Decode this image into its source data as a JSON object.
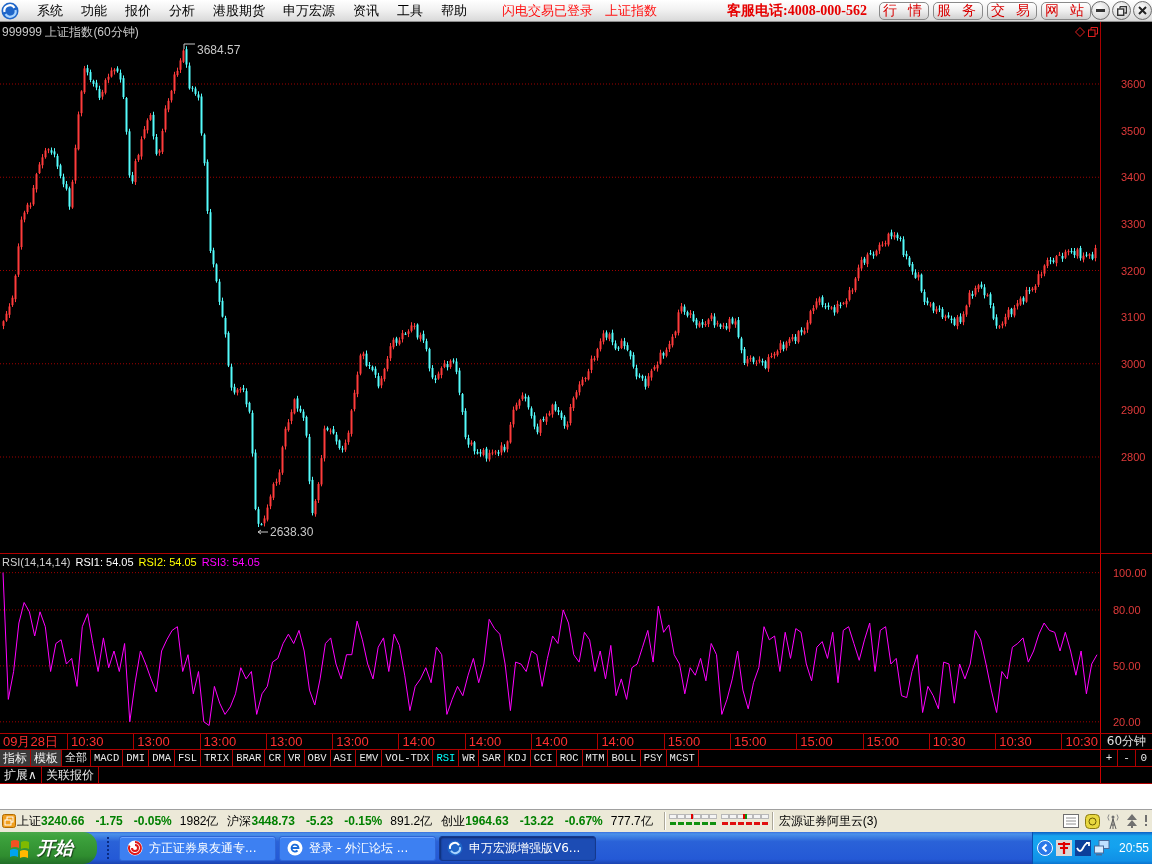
{
  "menu_bar": {
    "items": [
      "系统",
      "功能",
      "报价",
      "分析",
      "港股期货",
      "申万宏源",
      "资讯",
      "工具",
      "帮助"
    ],
    "login_status": "闪电交易已登录",
    "current_index": "上证指数",
    "hotline": "客服电话:4008-000-562",
    "service_buttons": [
      "行 情",
      "服 务",
      "交 易",
      "网 站"
    ]
  },
  "price_chart": {
    "title": "999999 上证指数(60分钟)",
    "high_label": "3684.57",
    "low_label": "2638.30",
    "axis_labels": [
      "3600",
      "3500",
      "3400",
      "3300",
      "3200",
      "3100",
      "3000",
      "2900",
      "2800"
    ]
  },
  "rsi_panel": {
    "name": "RSI(14,14,14)",
    "readings": [
      {
        "label": "RSI1: 54.05",
        "color": "#ffffff"
      },
      {
        "label": "RSI2: 54.05",
        "color": "#ffff00"
      },
      {
        "label": "RSI3: 54.05",
        "color": "#ff00ff"
      }
    ],
    "chart_data": {
      "type": "line",
      "grid": true,
      "ylim": [
        14,
        110
      ],
      "yticks": [
        {
          "value": 100,
          "label": "100.00"
        },
        {
          "value": 80,
          "label": "80.00"
        },
        {
          "value": 50,
          "label": "50.00"
        },
        {
          "value": 20,
          "label": "20.00"
        }
      ],
      "series": [
        {
          "color": "#ff00ff",
          "values": [
            100,
            32,
            47,
            73,
            84,
            79,
            66,
            79,
            71,
            47,
            62,
            64,
            51,
            54,
            39,
            71,
            78,
            62,
            47,
            65,
            49,
            58,
            47,
            62,
            20,
            41,
            58,
            51,
            43,
            36,
            58,
            64,
            69,
            71,
            47,
            56,
            35,
            47,
            20,
            18,
            39,
            30,
            24,
            28,
            35,
            49,
            43,
            47,
            24,
            35,
            39,
            52,
            54,
            62,
            67,
            62,
            69,
            58,
            37,
            29,
            43,
            62,
            65,
            51,
            43,
            56,
            56,
            74,
            64,
            51,
            43,
            60,
            65,
            47,
            67,
            61,
            45,
            26,
            39,
            43,
            49,
            41,
            60,
            56,
            24,
            32,
            39,
            34,
            45,
            54,
            41,
            51,
            75,
            70,
            67,
            51,
            26,
            52,
            51,
            47,
            58,
            56,
            39,
            54,
            66,
            62,
            80,
            73,
            56,
            52,
            68,
            64,
            47,
            58,
            43,
            61,
            34,
            43,
            32,
            49,
            51,
            60,
            69,
            52,
            82,
            68,
            72,
            56,
            51,
            35,
            49,
            45,
            54,
            42,
            62,
            56,
            24,
            32,
            43,
            58,
            37,
            27,
            41,
            49,
            71,
            64,
            66,
            47,
            68,
            54,
            70,
            68,
            51,
            42,
            60,
            63,
            54,
            68,
            41,
            69,
            71,
            62,
            53,
            64,
            73,
            47,
            69,
            71,
            51,
            54,
            34,
            33,
            47,
            56,
            25,
            39,
            34,
            27,
            52,
            51,
            30,
            51,
            43,
            51,
            69,
            64,
            51,
            37,
            25,
            47,
            43,
            60,
            62,
            65,
            52,
            58,
            67,
            73,
            69,
            68,
            58,
            68,
            58,
            45,
            58,
            35,
            51,
            56
          ]
        }
      ]
    }
  },
  "time_axis": {
    "labels": [
      "09月28日",
      "10:30",
      "13:00",
      "13:00",
      "13:00",
      "13:00",
      "14:00",
      "14:00",
      "14:00",
      "14:00",
      "15:00",
      "15:00",
      "15:00",
      "15:00",
      "10:30",
      "10:30",
      "10:30"
    ],
    "period": "60分钟"
  },
  "mode_buttons": [
    "指标",
    "模板"
  ],
  "indicator_tabs": [
    {
      "label": "全部",
      "selected": false
    },
    {
      "label": "MACD",
      "selected": false
    },
    {
      "label": "DMI",
      "selected": false
    },
    {
      "label": "DMA",
      "selected": false
    },
    {
      "label": "FSL",
      "selected": false
    },
    {
      "label": "TRIX",
      "selected": false
    },
    {
      "label": "BRAR",
      "selected": false
    },
    {
      "label": "CR",
      "selected": false
    },
    {
      "label": "VR",
      "selected": false
    },
    {
      "label": "OBV",
      "selected": false
    },
    {
      "label": "ASI",
      "selected": false
    },
    {
      "label": "EMV",
      "selected": false
    },
    {
      "label": "VOL-TDX",
      "selected": false
    },
    {
      "label": "RSI",
      "selected": true
    },
    {
      "label": "WR",
      "selected": false
    },
    {
      "label": "SAR",
      "selected": false
    },
    {
      "label": "KDJ",
      "selected": false
    },
    {
      "label": "CCI",
      "selected": false
    },
    {
      "label": "ROC",
      "selected": false
    },
    {
      "label": "MTM",
      "selected": false
    },
    {
      "label": "BOLL",
      "selected": false
    },
    {
      "label": "PSY",
      "selected": false
    },
    {
      "label": "MCST",
      "selected": false
    }
  ],
  "zoom_buttons": [
    "+",
    "-",
    "0"
  ],
  "extra_tabs": [
    "扩展∧",
    "关联报价"
  ],
  "status_bar": {
    "quotes": [
      {
        "name": "上证",
        "value": "3240.66",
        "change": "-1.75",
        "percent": "-0.05%",
        "turnover": "1982亿"
      },
      {
        "name": "沪深",
        "value": "3448.73",
        "change": "-5.23",
        "percent": "-0.15%",
        "turnover": "891.2亿"
      },
      {
        "name": "创业",
        "value": "1964.63",
        "change": "-13.22",
        "percent": "-0.67%",
        "turnover": "777.7亿"
      }
    ],
    "server": "宏源证券阿里云(3)"
  },
  "taskbar": {
    "start": "开始",
    "tasks": [
      {
        "label": "方正证券泉友通专...",
        "selected": false
      },
      {
        "label": "登录 - 外汇论坛 ...",
        "selected": false
      },
      {
        "label": "申万宏源增强版V6...",
        "selected": true
      }
    ],
    "clock": "20:55"
  }
}
